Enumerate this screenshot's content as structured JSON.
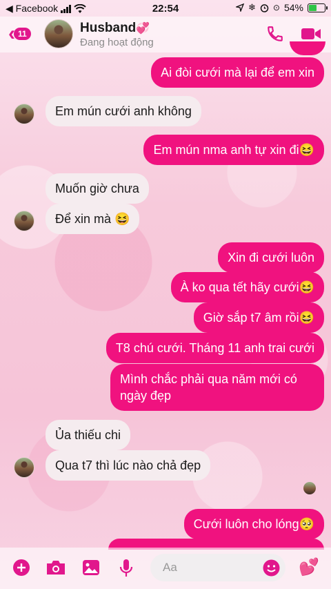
{
  "status_bar": {
    "carrier": "◀ Facebook",
    "time": "22:54",
    "battery_percent": "54%",
    "battery_level": 0.54
  },
  "header": {
    "back_badge": "11",
    "contact_name": "Husband",
    "contact_status": "Đang hoạt động"
  },
  "messages": [
    {
      "side": "out",
      "text": "Ai đòi cưới mà lại để em xin"
    },
    {
      "side": "in",
      "text": "Em mún cưới anh không"
    },
    {
      "side": "out",
      "text": "Em mún nma anh tự xin đi😆"
    },
    {
      "side": "in",
      "text": "Muốn giờ chưa"
    },
    {
      "side": "in",
      "text": "Để xin mà 😆"
    },
    {
      "side": "out",
      "text": "Xin đi cưới luôn"
    },
    {
      "side": "out",
      "text": "À ko qua tết hãy cưới😆"
    },
    {
      "side": "out",
      "text": "Giờ sắp t7 âm rồi😆"
    },
    {
      "side": "out",
      "text": "T8 chú cưới. Tháng 11 anh trai cưới"
    },
    {
      "side": "out",
      "text_line1": "Mình chắc phải qua năm mới có",
      "text_line2": "ngày đẹp"
    },
    {
      "side": "in",
      "text": "Ủa thiếu chi"
    },
    {
      "side": "in",
      "text": "Qua t7 thì lúc nào chả đẹp"
    },
    {
      "side": "out",
      "text": "Cưới luôn cho lóng🥺"
    }
  ],
  "composer": {
    "placeholder": "Aa"
  },
  "colors": {
    "accent": "#e1178c",
    "outgoing_bubble": "#f0127f",
    "incoming_bubble": "#f5ecef"
  }
}
